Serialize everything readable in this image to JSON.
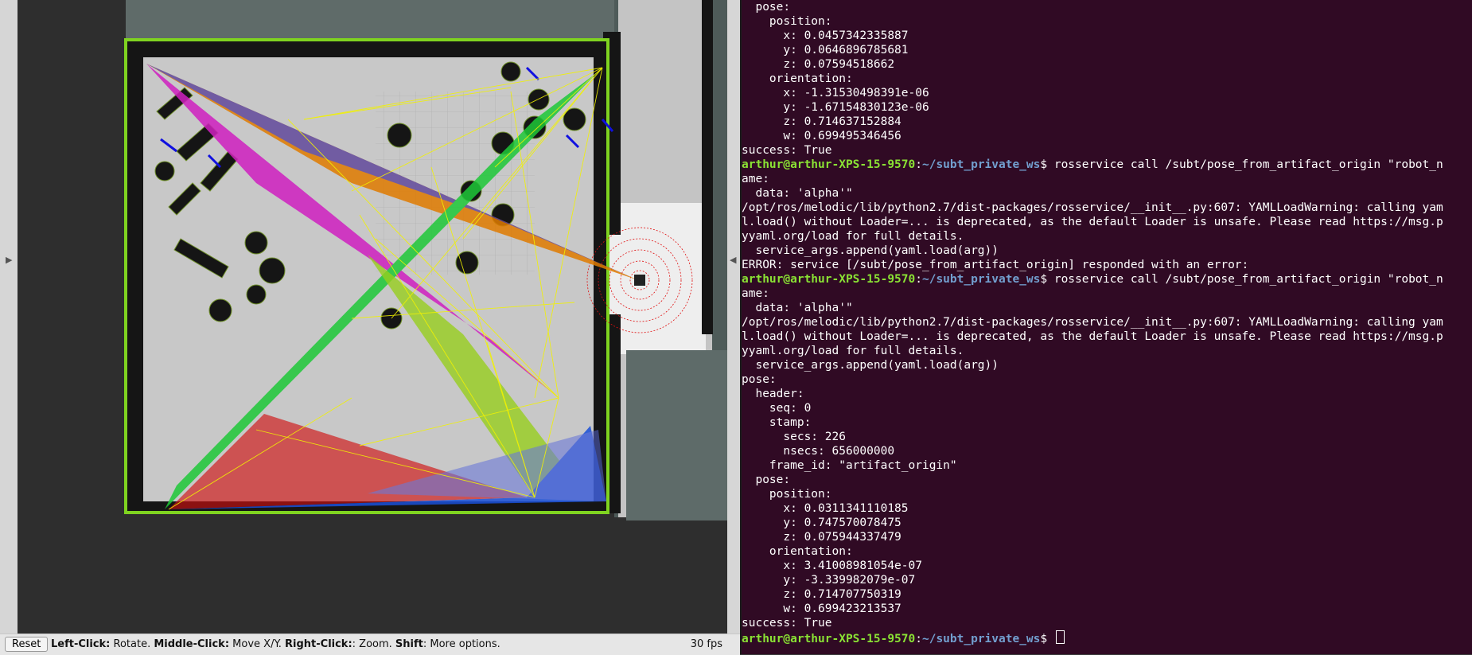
{
  "rviz": {
    "reset_label": "Reset",
    "help": [
      {
        "key": "Left-Click:",
        "desc": " Rotate. "
      },
      {
        "key": "Middle-Click:",
        "desc": " Move X/Y. "
      },
      {
        "key": "Right-Click:",
        "desc": ": Zoom. "
      },
      {
        "key": "Shift",
        "desc": ": More options."
      }
    ],
    "fps": "30 fps",
    "colors": {
      "map_floor": "#c8c8c8",
      "map_wall": "#111111",
      "map_border": "#7fd320",
      "path_orange": "#e07b00",
      "path_purple": "#3a3ad0",
      "path_magenta": "#d020c0",
      "path_green": "#1ec838",
      "path_lime": "#8fd000",
      "path_red": "#d01010",
      "path_blue": "#1a50d8",
      "rays_yellow": "#f2f200"
    }
  },
  "terminal": {
    "prompt_user": "arthur@arthur-XPS-15-9570",
    "prompt_path": "~/subt_private_ws",
    "lines": [
      {
        "t": "  pose:"
      },
      {
        "t": "    position:"
      },
      {
        "t": "      x: 0.0457342335887"
      },
      {
        "t": "      y: 0.0646896785681"
      },
      {
        "t": "      z: 0.07594518662"
      },
      {
        "t": "    orientation:"
      },
      {
        "t": "      x: -1.31530498391e-06"
      },
      {
        "t": "      y: -1.67154830123e-06"
      },
      {
        "t": "      z: 0.714637152884"
      },
      {
        "t": "      w: 0.699495346456"
      },
      {
        "t": "success: True"
      },
      {
        "prompt": true,
        "t": "$ rosservice call /subt/pose_from_artifact_origin \"robot_n"
      },
      {
        "t": "ame:"
      },
      {
        "t": "  data: 'alpha'\""
      },
      {
        "t": "/opt/ros/melodic/lib/python2.7/dist-packages/rosservice/__init__.py:607: YAMLLoadWarning: calling yam"
      },
      {
        "t": "l.load() without Loader=... is deprecated, as the default Loader is unsafe. Please read https://msg.p"
      },
      {
        "t": "yyaml.org/load for full details."
      },
      {
        "t": "  service_args.append(yaml.load(arg))"
      },
      {
        "t": "ERROR: service [/subt/pose_from_artifact_origin] responded with an error:"
      },
      {
        "prompt": true,
        "t": "$ rosservice call /subt/pose_from_artifact_origin \"robot_n"
      },
      {
        "t": "ame:"
      },
      {
        "t": "  data: 'alpha'\""
      },
      {
        "t": "/opt/ros/melodic/lib/python2.7/dist-packages/rosservice/__init__.py:607: YAMLLoadWarning: calling yam"
      },
      {
        "t": "l.load() without Loader=... is deprecated, as the default Loader is unsafe. Please read https://msg.p"
      },
      {
        "t": "yyaml.org/load for full details."
      },
      {
        "t": "  service_args.append(yaml.load(arg))"
      },
      {
        "t": "pose:"
      },
      {
        "t": "  header:"
      },
      {
        "t": "    seq: 0"
      },
      {
        "t": "    stamp:"
      },
      {
        "t": "      secs: 226"
      },
      {
        "t": "      nsecs: 656000000"
      },
      {
        "t": "    frame_id: \"artifact_origin\""
      },
      {
        "t": "  pose:"
      },
      {
        "t": "    position:"
      },
      {
        "t": "      x: 0.0311341110185"
      },
      {
        "t": "      y: 0.747570078475"
      },
      {
        "t": "      z: 0.075944337479"
      },
      {
        "t": "    orientation:"
      },
      {
        "t": "      x: 3.41008981054e-07"
      },
      {
        "t": "      y: -3.339982079e-07"
      },
      {
        "t": "      z: 0.714707750319"
      },
      {
        "t": "      w: 0.699423213537"
      },
      {
        "t": "success: True"
      },
      {
        "prompt": true,
        "cursor": true,
        "t": "$ "
      }
    ]
  }
}
